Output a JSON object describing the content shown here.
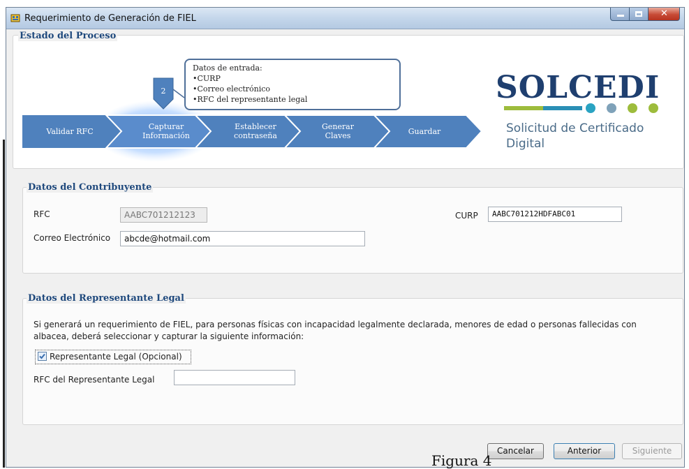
{
  "window": {
    "title": "Requerimiento de Generación de FIEL"
  },
  "process": {
    "legend": "Estado del Proceso",
    "current_step_number": "2",
    "steps": [
      {
        "line1": "Validar RFC",
        "line2": ""
      },
      {
        "line1": "Capturar",
        "line2": "Información"
      },
      {
        "line1": "Establecer",
        "line2": "contraseña"
      },
      {
        "line1": "Generar",
        "line2": "Claves"
      },
      {
        "line1": "Guardar",
        "line2": ""
      }
    ],
    "callout": {
      "heading": "Datos de entrada:",
      "items": [
        "•CURP",
        "•Correo electrónico",
        "•RFC del representante legal"
      ]
    }
  },
  "brand": {
    "name": "SOLCEDI",
    "subtitle_line1": "Solicitud de Certificado",
    "subtitle_line2": "Digital",
    "dot_colors": [
      "#2aa3c2",
      "#7fa2b9",
      "#9dbc3c",
      "#9dbc3c"
    ]
  },
  "contribuyente": {
    "legend": "Datos del Contribuyente",
    "rfc_label": "RFC",
    "rfc_value": "AABC701212123",
    "curp_label": "CURP",
    "curp_value": "AABC701212HDFABC01",
    "email_label": "Correo Electrónico",
    "email_value": "abcde@hotmail.com"
  },
  "representante": {
    "legend": "Datos del Representante Legal",
    "description_line1": "Si generará un requerimiento de FIEL, para personas físicas con incapacidad legalmente declarada, menores de edad o personas fallecidas con",
    "description_line2": "albacea, deberá seleccionar y capturar la siguiente información:",
    "checkbox_label": "Representante Legal (Opcional)",
    "checkbox_checked": true,
    "rfc_rep_label": "RFC del Representante Legal",
    "rfc_rep_value": ""
  },
  "buttons": {
    "cancel": "Cancelar",
    "previous": "Anterior",
    "next": "Siguiente"
  },
  "caption": "Figura 4"
}
